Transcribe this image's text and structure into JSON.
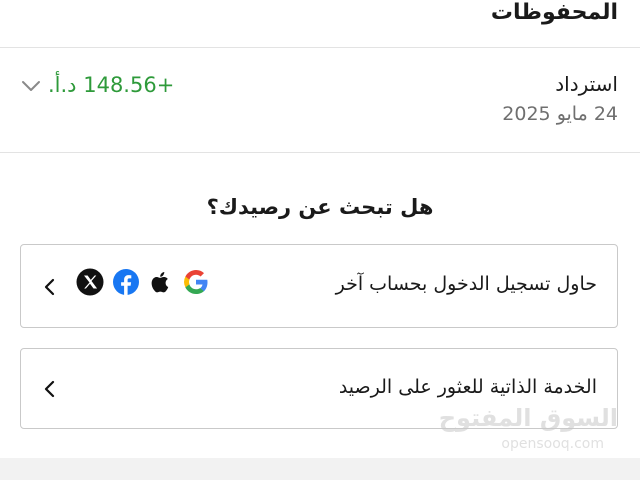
{
  "section": {
    "title": "المحفوظات"
  },
  "transaction": {
    "type": "استرداد",
    "date": "24 مايو 2025",
    "amount": "+148.56 د.أ.",
    "amount_color": "#2e9a3a",
    "expand_icon": "chevron-down-icon"
  },
  "help": {
    "title": "هل تبحث عن رصيدك؟",
    "options": [
      {
        "label": "حاول تسجيل الدخول بحساب آخر",
        "icons": [
          "google-icon",
          "apple-icon",
          "facebook-icon",
          "x-icon"
        ],
        "arrow_icon": "chevron-left-icon"
      },
      {
        "label": "الخدمة الذاتية للعثور على الرصيد",
        "arrow_icon": "chevron-left-icon"
      }
    ]
  },
  "watermark": {
    "main": "السوق المفتوح",
    "sub": "opensooq.com"
  }
}
